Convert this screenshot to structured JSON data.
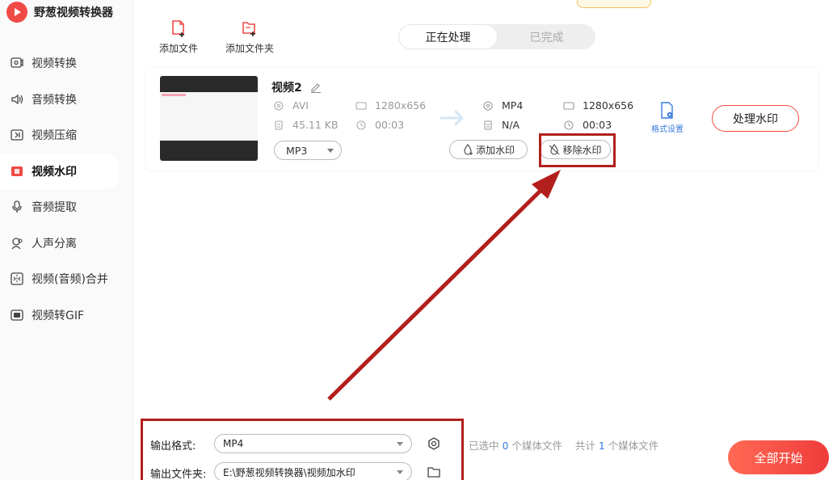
{
  "app": {
    "title": "野葱视频转换器"
  },
  "sidebar": {
    "items": [
      {
        "label": "视频转换",
        "icon": "video-convert-icon"
      },
      {
        "label": "音频转换",
        "icon": "audio-convert-icon"
      },
      {
        "label": "视频压缩",
        "icon": "video-compress-icon"
      },
      {
        "label": "视频水印",
        "icon": "video-watermark-icon",
        "active": true
      },
      {
        "label": "音频提取",
        "icon": "audio-extract-icon"
      },
      {
        "label": "人声分离",
        "icon": "voice-separate-icon"
      },
      {
        "label": "视频(音频)合并",
        "icon": "merge-icon"
      },
      {
        "label": "视频转GIF",
        "icon": "gif-icon"
      }
    ]
  },
  "toolbar": {
    "add_file": "添加文件",
    "add_folder": "添加文件夹"
  },
  "tabs": [
    {
      "label": "正在处理",
      "active": true
    },
    {
      "label": "已完成",
      "active": false
    }
  ],
  "file": {
    "name": "视频2",
    "source": {
      "format": "AVI",
      "resolution": "1280x656",
      "size": "45.11 KB",
      "duration": "00:03"
    },
    "target": {
      "format": "MP4",
      "resolution": "1280x656",
      "size": "N/A",
      "duration": "00:03"
    },
    "audio_format": "MP3",
    "add_watermark": "添加水印",
    "remove_watermark": "移除水印",
    "format_settings": "格式设置",
    "process": "处理水印"
  },
  "bottom": {
    "output_format_label": "输出格式:",
    "output_format_value": "MP4",
    "output_folder_label": "输出文件夹:",
    "output_folder_value": "E:\\野葱视频转换器\\视频加水印",
    "status_selected_prefix": "已选中",
    "status_selected_count": "0",
    "status_selected_suffix": "个媒体文件",
    "status_total_prefix": "共计",
    "status_total_count": "1",
    "status_total_suffix": "个媒体文件",
    "start_all": "全部开始"
  },
  "colors": {
    "accent": "#ef4a45",
    "annotation": "#b21f1c",
    "link": "#3a7be0"
  }
}
